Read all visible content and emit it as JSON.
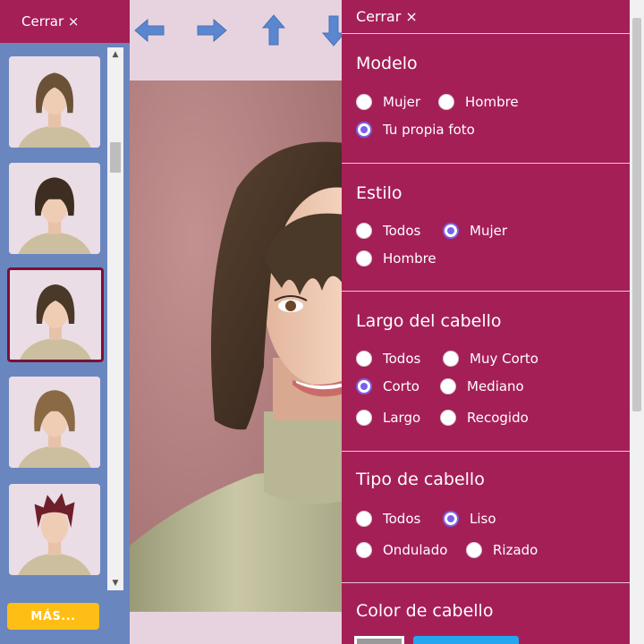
{
  "left_panel": {
    "close_label": "Cerrar ×",
    "more_label": "MÁS...",
    "thumbnails": [
      {
        "style": "bob-fringe",
        "hair_color": "#6b5236",
        "selected": false
      },
      {
        "style": "bob-fringe-dark",
        "hair_color": "#3e2e22",
        "selected": false
      },
      {
        "style": "bob-fringe",
        "hair_color": "#4a3828",
        "selected": true
      },
      {
        "style": "bob-fringe-light",
        "hair_color": "#8a6a45",
        "selected": false
      },
      {
        "style": "short-spiky",
        "hair_color": "#6e1f2a",
        "selected": false
      }
    ]
  },
  "toolbar": {
    "arrows": [
      "arrow-left-icon",
      "arrow-right-icon",
      "arrow-up-icon",
      "arrow-down-icon"
    ],
    "arrow_color": "#5a87cf"
  },
  "right_panel": {
    "close_label": "Cerrar ×",
    "sections": {
      "modelo": {
        "title": "Modelo",
        "options": [
          {
            "label": "Mujer",
            "checked": false
          },
          {
            "label": "Hombre",
            "checked": false
          },
          {
            "label": "Tu propia foto",
            "checked": true
          }
        ]
      },
      "estilo": {
        "title": "Estilo",
        "options": [
          {
            "label": "Todos",
            "checked": false
          },
          {
            "label": "Mujer",
            "checked": true
          },
          {
            "label": "Hombre",
            "checked": false
          }
        ]
      },
      "largo": {
        "title": "Largo del cabello",
        "options": [
          {
            "label": "Todos",
            "checked": false
          },
          {
            "label": "Muy Corto",
            "checked": false
          },
          {
            "label": "Corto",
            "checked": true
          },
          {
            "label": "Mediano",
            "checked": false
          },
          {
            "label": "Largo",
            "checked": false
          },
          {
            "label": "Recogido",
            "checked": false
          }
        ]
      },
      "tipo": {
        "title": "Tipo de cabello",
        "options": [
          {
            "label": "Todos",
            "checked": false
          },
          {
            "label": "Liso",
            "checked": true
          },
          {
            "label": "Ondulado",
            "checked": false
          },
          {
            "label": "Rizado",
            "checked": false
          }
        ]
      },
      "color": {
        "title": "Color de cabello"
      }
    }
  },
  "colors": {
    "panel_bg": "#a51f57",
    "left_bg": "#6a86bf",
    "page_bg": "#e7d3df",
    "accent_button": "#ffbe15",
    "radio_checked": "#7b61e6"
  }
}
